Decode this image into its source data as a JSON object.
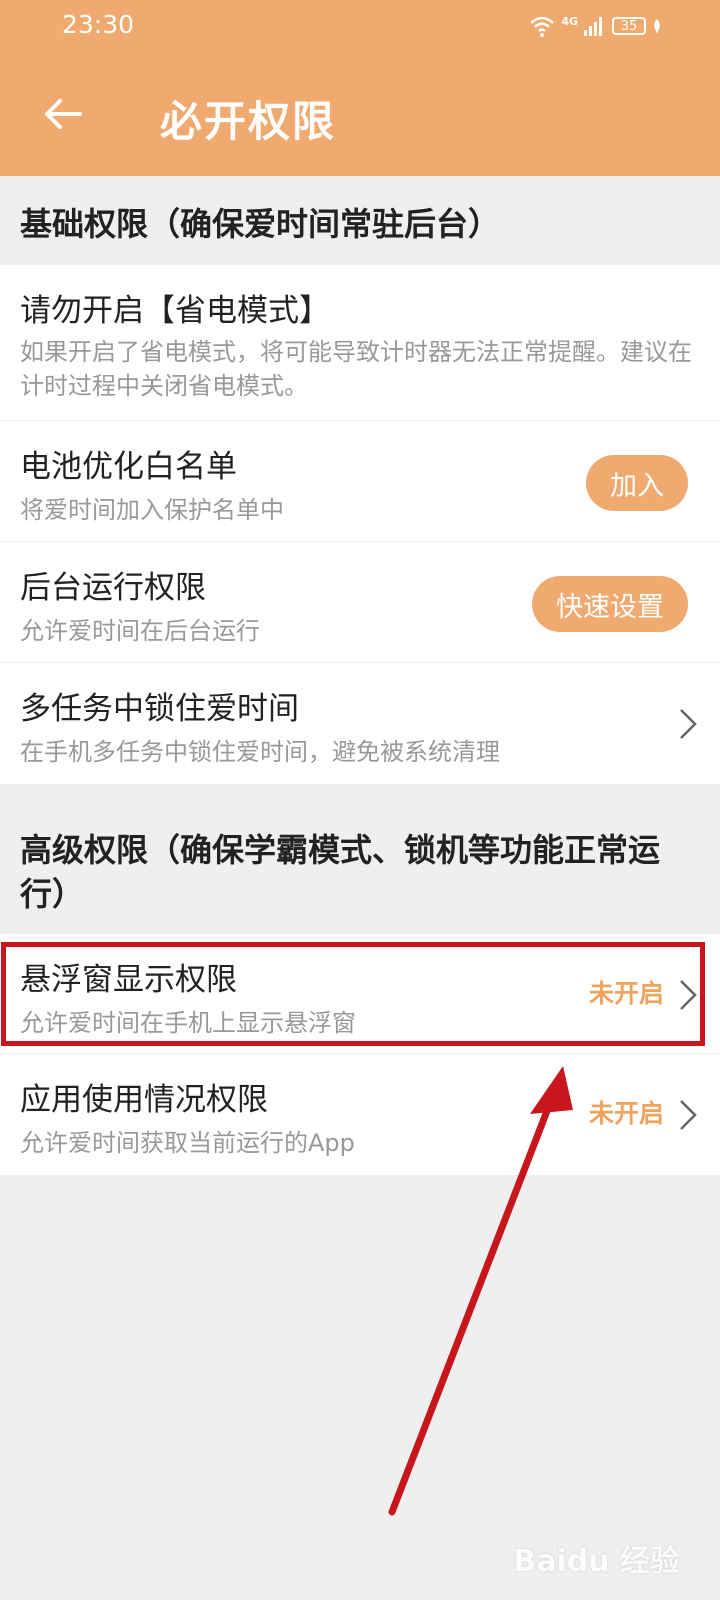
{
  "status_bar": {
    "time": "23:30",
    "network": "4G",
    "battery": "35"
  },
  "header": {
    "title": "必开权限",
    "back_icon": "arrow-left-icon"
  },
  "sections": [
    {
      "title": "基础权限（确保爱时间常驻后台）",
      "items": [
        {
          "title": "请勿开启【省电模式】",
          "desc": "如果开启了省电模式，将可能导致计时器无法正常提醒。建议在计时过程中关闭省电模式。"
        },
        {
          "title": "电池优化白名单",
          "desc": "将爱时间加入保护名单中",
          "action": "加入"
        },
        {
          "title": "后台运行权限",
          "desc": "允许爱时间在后台运行",
          "action": "快速设置"
        },
        {
          "title": "多任务中锁住爱时间",
          "desc": "在手机多任务中锁住爱时间，避免被系统清理"
        }
      ]
    },
    {
      "title": "高级权限（确保学霸模式、锁机等功能正常运行）",
      "items": [
        {
          "title": "悬浮窗显示权限",
          "desc": "允许爱时间在手机上显示悬浮窗",
          "status": "未开启"
        },
        {
          "title": "应用使用情况权限",
          "desc": "允许爱时间获取当前运行的App",
          "status": "未开启"
        }
      ]
    }
  ],
  "colors": {
    "accent": "#f0aa6f",
    "highlight": "#c8161d",
    "status": "#f0a35c"
  },
  "watermark": "Baidu 经验"
}
